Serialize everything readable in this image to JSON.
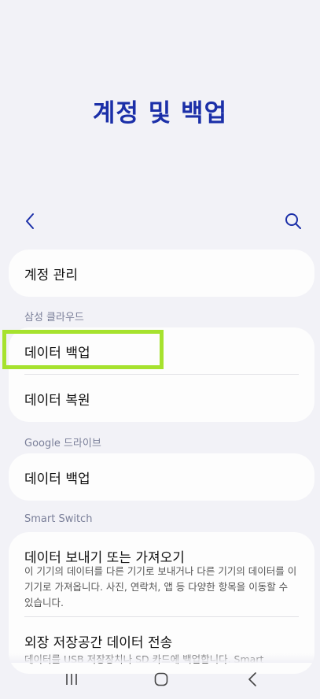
{
  "header": {
    "title": "계정 및 백업"
  },
  "toolbar": {
    "back_icon": "chevron-left-icon",
    "search_icon": "search-icon"
  },
  "account": {
    "manage_label": "계정 관리"
  },
  "samsung_cloud": {
    "section_title": "삼성 클라우드",
    "items": [
      {
        "label": "데이터 백업"
      },
      {
        "label": "데이터 복원"
      }
    ]
  },
  "google_drive": {
    "section_title": "Google 드라이브",
    "items": [
      {
        "label": "데이터 백업"
      }
    ]
  },
  "smart_switch": {
    "section_title": "Smart Switch",
    "transfer": {
      "label": "데이터 보내기 또는 가져오기",
      "desc": "이 기기의 데이터를 다른 기기로 보내거나 다른 기기의 데이터를 이 기기로 가져옵니다. 사진, 연락처, 앱 등 다양한 항목을 이동할 수 있습니다."
    },
    "external": {
      "label": "외장 저장공간 데이터 전송",
      "desc": "데이터를 USB 저장장치나 SD 카드에 백업합니다. Smart"
    }
  },
  "navbar": {
    "recents_icon": "recents-icon",
    "home_icon": "home-icon",
    "back_icon": "back-icon"
  }
}
